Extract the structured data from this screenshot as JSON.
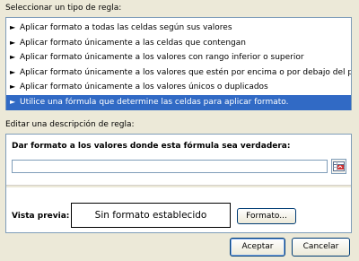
{
  "rule_type_section": {
    "label": "Seleccionar un tipo de regla:",
    "items": [
      {
        "label": "Aplicar formato a todas las celdas según sus valores"
      },
      {
        "label": "Aplicar formato únicamente a las celdas que contengan"
      },
      {
        "label": "Aplicar formato únicamente a los valores con rango inferior o superior"
      },
      {
        "label": "Aplicar formato únicamente a los valores que estén por encima o por debajo del promedio"
      },
      {
        "label": "Aplicar formato únicamente a los valores únicos o duplicados"
      },
      {
        "label": "Utilice una fórmula que determine las celdas para aplicar formato."
      }
    ],
    "arrow_glyph": "►",
    "selected_index": 5
  },
  "description_section": {
    "label": "Editar una descripción de regla:",
    "formula_title": "Dar formato a los valores donde esta fórmula sea verdadera:",
    "formula_value": "",
    "preview_label": "Vista previa:",
    "preview_text": "Sin formato establecido",
    "format_button": "Formato..."
  },
  "footer": {
    "accept_button": "Aceptar",
    "cancel_button": "Cancelar"
  },
  "colors": {
    "selection": "#316ac5",
    "dialog_bg": "#ece9d8",
    "field_border": "#7f9db9"
  }
}
